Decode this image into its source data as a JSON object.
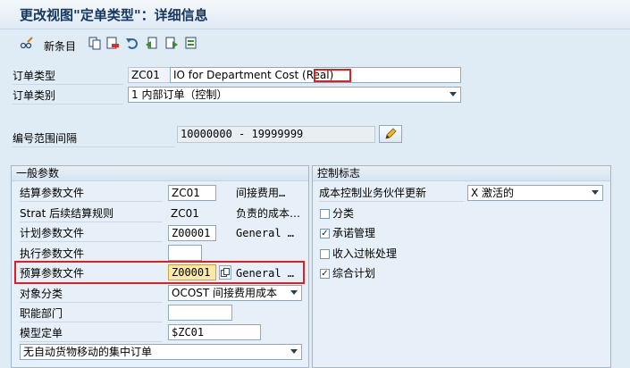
{
  "window": {
    "title": "更改视图\"定单类型\"：详细信息"
  },
  "toolbar": {
    "new_entries_label": "新条目",
    "icons": [
      "glasses-pencil-icon",
      "copy-icon",
      "delete-icon",
      "undo-icon",
      "previous-entry-icon",
      "next-entry-icon",
      "other-entry-icon"
    ]
  },
  "header": {
    "order_type_label": "订单类型",
    "order_type_code": "ZC01",
    "order_type_desc": "IO for Department Cost (Real)",
    "order_category_label": "订单类别",
    "order_category_value": "1 内部订单（控制）",
    "number_range_label": "编号范围间隔",
    "number_range_value": "10000000 - 19999999"
  },
  "general": {
    "title": "一般参数",
    "settlement_profile_label": "结算参数文件",
    "settlement_profile_value": "ZC01",
    "settlement_profile_desc": "间接费用…",
    "strat_rule_label": "Strat 后续结算规则",
    "strat_rule_value": "ZC01",
    "strat_rule_desc": "负责的成本…",
    "planning_profile_label": "计划参数文件",
    "planning_profile_value": "Z00001",
    "planning_profile_desc": "General …",
    "execution_profile_label": "执行参数文件",
    "execution_profile_value": "",
    "budget_profile_label": "预算参数文件",
    "budget_profile_value": "Z00001",
    "budget_profile_desc": "General …",
    "object_class_label": "对象分类",
    "object_class_value": "OCOST 间接费用成本",
    "functional_area_label": "职能部门",
    "functional_area_value": "",
    "model_order_label": "模型定单",
    "model_order_value": "$ZC01",
    "collective_order_value": "无自动货物移动的集中订单"
  },
  "control": {
    "title": "控制标志",
    "cost_partner_label": "成本控制业务伙伴更新",
    "cost_partner_value": "X 激活的",
    "checkboxes": [
      {
        "label": "分类",
        "checked": false,
        "mark": ""
      },
      {
        "label": "承诺管理",
        "checked": true,
        "mark": "✓"
      },
      {
        "label": "收入过帐处理",
        "checked": false,
        "mark": ""
      },
      {
        "label": "综合计划",
        "checked": true,
        "mark": "✓"
      }
    ]
  },
  "colors": {
    "highlight": "#e0201f",
    "accent": "#15365e",
    "panel": "#dfebf5"
  }
}
